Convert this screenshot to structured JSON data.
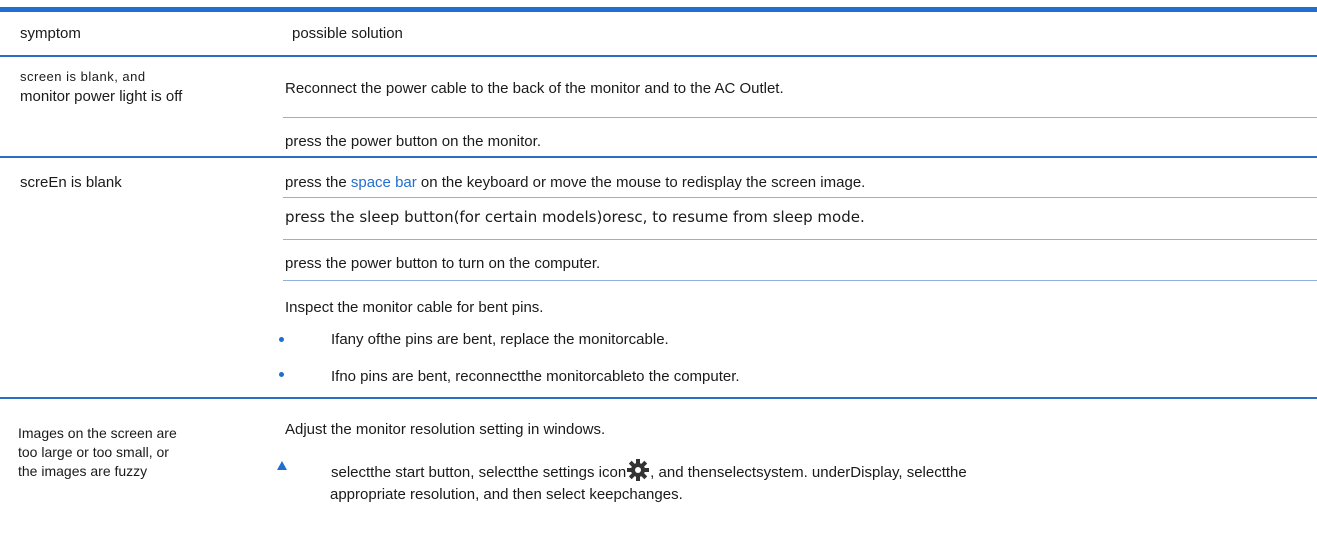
{
  "header": {
    "symptom": "symptom",
    "solution": "possible solution"
  },
  "rows": [
    {
      "symptom_line1": "screen is blank, and",
      "symptom_line2": "monitor power light is off",
      "solutions": [
        "Reconnect the power cable to the back of the monitor and to the AC Outlet.",
        "press the power button on the monitor."
      ]
    },
    {
      "symptom": "screEn is blank",
      "solution1_pre": "press the ",
      "solution1_link": "space bar",
      "solution1_post": " on the keyboard or move the mouse to redisplay the screen image.",
      "solution2": "press the sleep button(for certain models)oresc, to resume from sleep mode.",
      "solution3": "press the power button to turn on the computer.",
      "solution4": "Inspect the monitor cable for bent pins.",
      "bullets": [
        "Ifany ofthe pins are bent, replace the monitorcable.",
        "Ifno pins are bent, reconnectthe monitorcableto the computer."
      ]
    },
    {
      "symptom_line1": "Images on the screen are",
      "symptom_line2": "too large or too small, or",
      "symptom_line3": "the images are fuzzy",
      "solution": "Adjust the monitor resolution setting in windows.",
      "step_pre": "selectthe start button, selectthe settings icon",
      "step_post": ", and thenselectsystem. underDisplay, selectthe",
      "step_line2": "appropriate resolution, and then select keepchanges."
    }
  ],
  "colors": {
    "accent": "#1f6fd1"
  },
  "icons": {
    "settings": "gear-icon"
  }
}
